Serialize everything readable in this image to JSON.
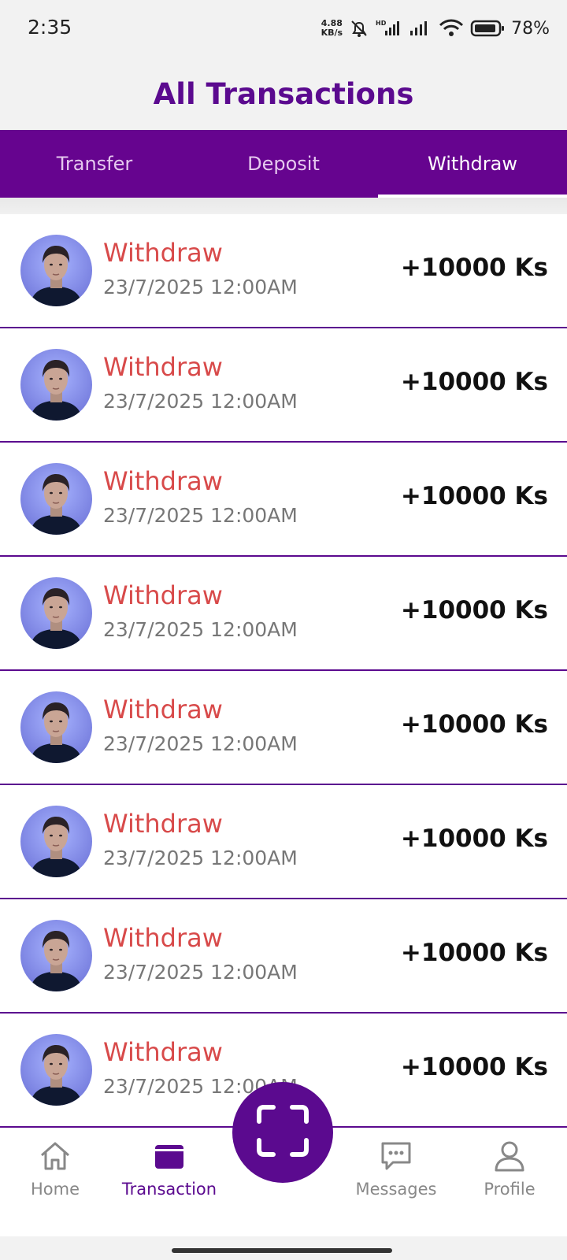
{
  "status_bar": {
    "time": "2:35",
    "net_speed_value": "4.88",
    "net_speed_unit": "KB/s",
    "battery_percent": "78%",
    "icons": [
      "mute-bell-icon",
      "hd-signal-icon",
      "signal-icon",
      "wifi-icon",
      "battery-icon"
    ]
  },
  "header": {
    "title": "All Transactions"
  },
  "tabs": [
    {
      "label": "Transfer",
      "active": false
    },
    {
      "label": "Deposit",
      "active": false
    },
    {
      "label": "Withdraw",
      "active": true
    }
  ],
  "transactions": [
    {
      "title": "Withdraw",
      "date": "23/7/2025 12:00AM",
      "amount": "+10000 Ks"
    },
    {
      "title": "Withdraw",
      "date": "23/7/2025 12:00AM",
      "amount": "+10000 Ks"
    },
    {
      "title": "Withdraw",
      "date": "23/7/2025 12:00AM",
      "amount": "+10000 Ks"
    },
    {
      "title": "Withdraw",
      "date": "23/7/2025 12:00AM",
      "amount": "+10000 Ks"
    },
    {
      "title": "Withdraw",
      "date": "23/7/2025 12:00AM",
      "amount": "+10000 Ks"
    },
    {
      "title": "Withdraw",
      "date": "23/7/2025 12:00AM",
      "amount": "+10000 Ks"
    },
    {
      "title": "Withdraw",
      "date": "23/7/2025 12:00AM",
      "amount": "+10000 Ks"
    },
    {
      "title": "Withdraw",
      "date": "23/7/2025 12:00AM",
      "amount": "+10000 Ks"
    }
  ],
  "bottom_nav": {
    "home": {
      "label": "Home",
      "icon": "home-icon"
    },
    "transaction": {
      "label": "Transaction",
      "icon": "wallet-icon",
      "active": true
    },
    "scan": {
      "icon": "scan-icon"
    },
    "messages": {
      "label": "Messages",
      "icon": "chat-icon"
    },
    "profile": {
      "label": "Profile",
      "icon": "user-icon"
    }
  },
  "colors": {
    "brand": "#5b0a8f",
    "tab_bar": "#66048f",
    "withdraw_text": "#d84a4a",
    "divider": "#5b0a8f"
  }
}
